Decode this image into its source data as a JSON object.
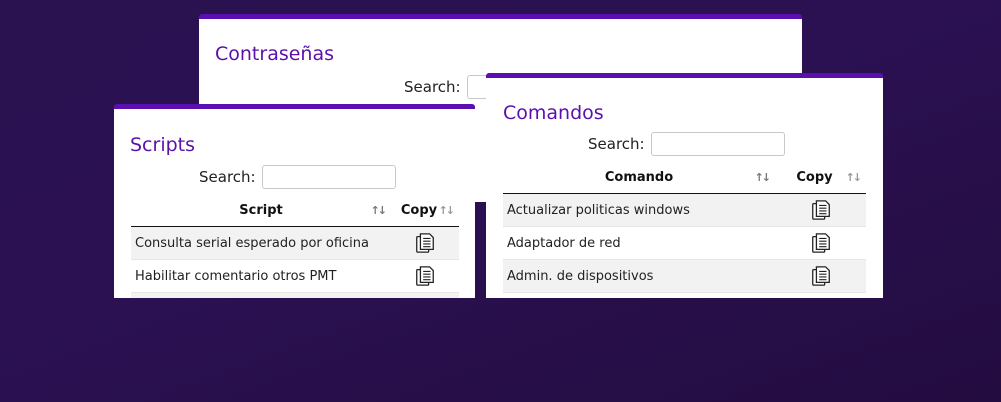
{
  "contrasenas": {
    "title": "Contraseñas",
    "search_label": "Search:"
  },
  "scripts": {
    "title": "Scripts",
    "search_label": "Search:",
    "columns": [
      "Script",
      "Copy"
    ],
    "rows": [
      "Consulta serial esperado por oficina",
      "Habilitar comentario otros PMT"
    ]
  },
  "comandos": {
    "title": "Comandos",
    "search_label": "Search:",
    "columns": [
      "Comando",
      "Copy"
    ],
    "rows": [
      "Actualizar politicas windows",
      "Adaptador de red",
      "Admin. de dispositivos"
    ]
  },
  "icons": {
    "copy": "copy-document-icon"
  },
  "colors": {
    "accent": "#5a0fb0",
    "title": "#5b10ad",
    "background": "#2a1150"
  }
}
